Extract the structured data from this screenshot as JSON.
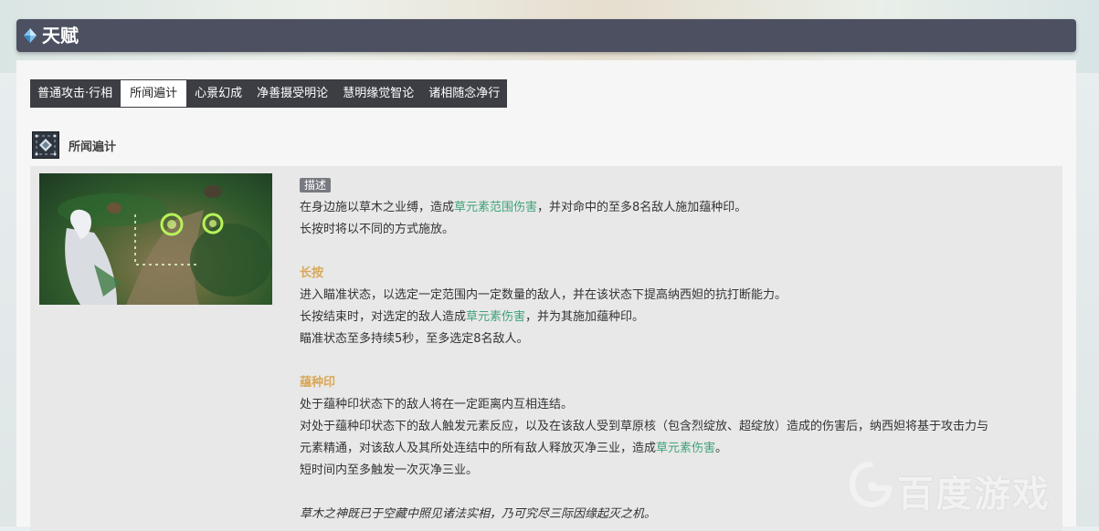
{
  "header": {
    "title": "天赋"
  },
  "tabs": [
    {
      "label": "普通攻击·行相",
      "active": false
    },
    {
      "label": "所闻遍计",
      "active": true
    },
    {
      "label": "心景幻成",
      "active": false
    },
    {
      "label": "净善摄受明论",
      "active": false
    },
    {
      "label": "慧明缘觉智论",
      "active": false
    },
    {
      "label": "诸相随念净行",
      "active": false
    }
  ],
  "skill": {
    "name": "所闻遍计",
    "icon": "skill-rune-icon"
  },
  "description": {
    "tag": "描述",
    "p1_a": "在身边施以草木之业缚，造成",
    "p1_hl": "草元素范围伤害",
    "p1_b": "，并对命中的至多8名敌人施加蕴种印。",
    "p2": "长按时将以不同的方式施放。",
    "hold_title": "长按",
    "hold_1": "进入瞄准状态，以选定一定范围内一定数量的敌人，并在该状态下提高纳西妲的抗打断能力。",
    "hold_2_a": "长按结束时，对选定的敌人造成",
    "hold_2_hl": "草元素伤害",
    "hold_2_b": "，并为其施加蕴种印。",
    "hold_3": "瞄准状态至多持续5秒，至多选定8名敌人。",
    "seed_title": "蕴种印",
    "seed_1": "处于蕴种印状态下的敌人将在一定距离内互相连结。",
    "seed_2": "对处于蕴种印状态下的敌人触发元素反应，以及在该敌人受到草原核（包含烈绽放、超绽放）造成的伤害后，纳西妲将基于攻击力与",
    "seed_3_a": "元素精通，对该敌人及其所处连结中的所有敌人释放灭净三业，造成",
    "seed_3_hl": "草元素伤害",
    "seed_3_b": "。",
    "seed_4": "短时间内至多触发一次灭净三业。",
    "quote": "草木之神既已于空藏中照见诸法实相，乃可究尽三际因缘起灭之机。"
  },
  "watermark": {
    "text": "百度游戏"
  },
  "colors": {
    "header_bg": "#4c5060",
    "subtitle": "#d9a757",
    "dendro": "#3fa37a",
    "tab_bar": "#3c3e44"
  }
}
